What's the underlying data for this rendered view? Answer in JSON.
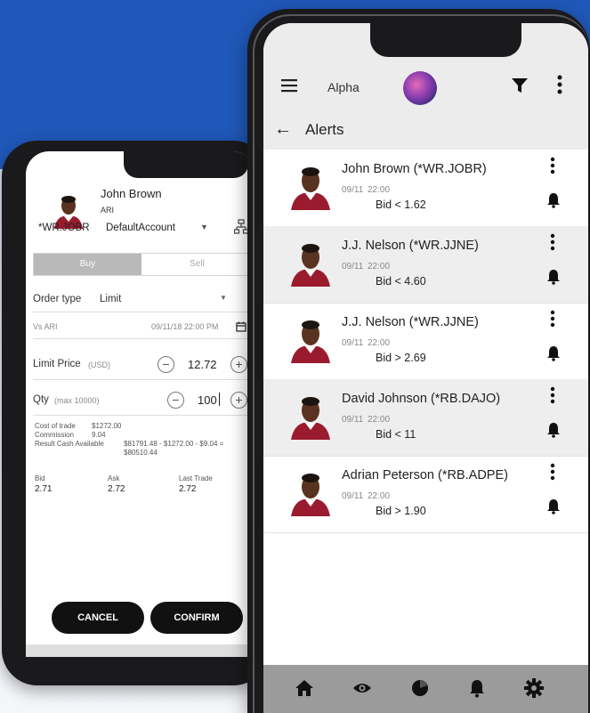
{
  "left_phone": {
    "player_name": "John Brown",
    "team": "ARI",
    "symbol": "*WR.JOBR",
    "account": "DefaultAccount",
    "tab_buy": "Buy",
    "tab_sell": "Sell",
    "order_type_label": "Order type",
    "order_type_value": "Limit",
    "vs_label": "Vs ARI",
    "vs_datetime": "09/11/18 22:00 PM",
    "limit_price_label": "Limit Price",
    "limit_price_unit": "(USD)",
    "limit_price_value": "12.72",
    "qty_label": "Qty",
    "qty_max": "(max 10000)",
    "qty_value": "100",
    "cost_label": "Cost of trade",
    "cost_value": "$1272.00",
    "commission_label": "Commission",
    "commission_value": "9.04",
    "result_label": "Result Cash Available",
    "result_value_line1": "$81791.48 - $1272.00 - $9.04 =",
    "result_value_line2": "$80510.44",
    "bid_label": "Bid",
    "ask_label": "Ask",
    "last_trade_label": "Last Trade",
    "bid_value": "2.71",
    "ask_value": "2.72",
    "last_trade_value": "2.72",
    "cancel_label": "CANCEL",
    "confirm_label": "CONFIRM"
  },
  "right_phone": {
    "app_title": "Alpha",
    "page_title": "Alerts",
    "alerts": [
      {
        "name": "John Brown (*WR.JOBR)",
        "date": "09/11",
        "time": "22:00",
        "condition": "Bid  <  1.62"
      },
      {
        "name": "J.J. Nelson (*WR.JJNE)",
        "date": "09/11",
        "time": "22:00",
        "condition": "Bid  <  4.60"
      },
      {
        "name": "J.J. Nelson (*WR.JJNE)",
        "date": "09/11",
        "time": "22:00",
        "condition": "Bid  >  2.69"
      },
      {
        "name": "David Johnson (*RB.DAJO)",
        "date": "09/11",
        "time": "22:00",
        "condition": "Bid  <  11"
      },
      {
        "name": "Adrian Peterson (*RB.ADPE)",
        "date": "09/11",
        "time": "22:00",
        "condition": "Bid  >  1.90"
      }
    ],
    "nav_icons": [
      "home-icon",
      "eye-icon",
      "pie-chart-icon",
      "bell-icon",
      "gear-icon"
    ]
  },
  "colors": {
    "background_blue": "#2058b9",
    "phone_frame": "#1a1a1c",
    "nav_bar": "#9b9b9b",
    "header_gray": "#ececec",
    "button_black": "#111111"
  }
}
